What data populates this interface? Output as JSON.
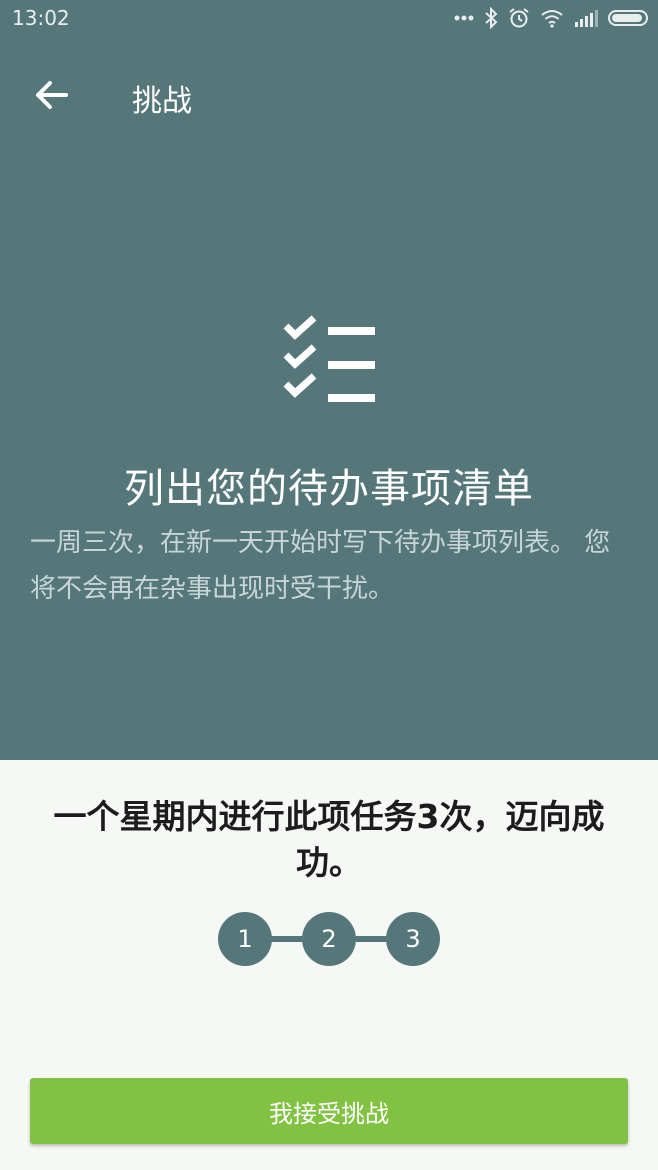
{
  "statusbar": {
    "time": "13:02",
    "icons": [
      "more-dots-icon",
      "bluetooth-icon",
      "alarm-icon",
      "wifi-icon",
      "signal-icon",
      "battery-icon"
    ]
  },
  "toolbar": {
    "back_icon": "arrow-left-icon",
    "title": "挑战"
  },
  "hero": {
    "icon": "checklist-icon",
    "title": "列出您的待办事项清单",
    "description": "一周三次，在新一天开始时写下待办事项列表。 您将不会再在杂事出现时受干扰。"
  },
  "goal": {
    "text": "一个星期内进行此项任务3次，迈向成功。"
  },
  "steps": [
    "1",
    "2",
    "3"
  ],
  "accept_button": {
    "label": "我接受挑战"
  },
  "colors": {
    "hero_bg": "#567779",
    "accent_green": "#82c242",
    "step_color": "#567779"
  }
}
